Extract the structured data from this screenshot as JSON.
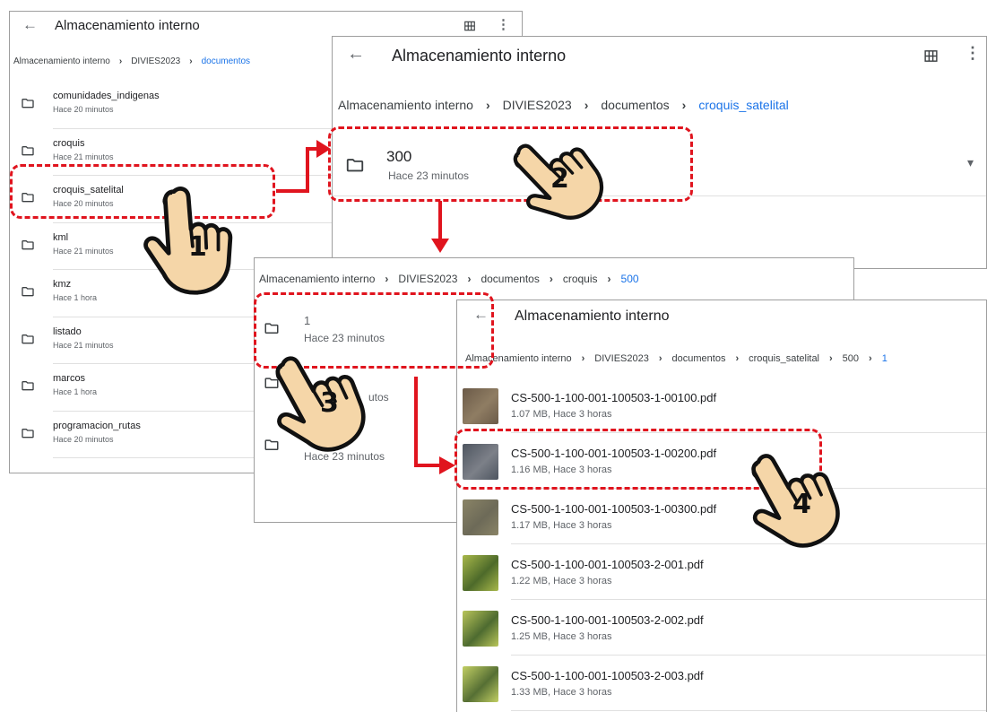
{
  "app_title": "Almacenamiento interno",
  "panel1": {
    "breadcrumb": [
      "Almacenamiento interno",
      "DIVIES2023",
      "documentos"
    ],
    "items": [
      {
        "name": "comunidades_indigenas",
        "meta": "Hace 20 minutos"
      },
      {
        "name": "croquis",
        "meta": "Hace 21 minutos"
      },
      {
        "name": "croquis_satelital",
        "meta": "Hace 20 minutos"
      },
      {
        "name": "kml",
        "meta": "Hace 21 minutos"
      },
      {
        "name": "kmz",
        "meta": "Hace 1 hora"
      },
      {
        "name": "listado",
        "meta": "Hace 21 minutos"
      },
      {
        "name": "marcos",
        "meta": "Hace 1 hora"
      },
      {
        "name": "programacion_rutas",
        "meta": "Hace 20 minutos"
      }
    ]
  },
  "panel2": {
    "breadcrumb": [
      "Almacenamiento interno",
      "DIVIES2023",
      "documentos",
      "croquis_satelital"
    ],
    "items": [
      {
        "name": "300",
        "meta": "Hace 23 minutos"
      }
    ]
  },
  "panel3": {
    "breadcrumb": [
      "Almacenamiento interno",
      "DIVIES2023",
      "documentos",
      "croquis",
      "500"
    ],
    "items": [
      {
        "name": "1",
        "meta": "Hace 23 minutos"
      },
      {
        "name": "",
        "meta": "utos"
      },
      {
        "name": "3",
        "meta": "Hace 23 minutos"
      }
    ]
  },
  "panel4": {
    "breadcrumb": [
      "Almacenamiento interno",
      "DIVIES2023",
      "documentos",
      "croquis_satelital",
      "500",
      "1"
    ],
    "files": [
      {
        "name": "CS-500-1-100-001-100503-1-00100.pdf",
        "meta": "1.07 MB, Hace 3 horas"
      },
      {
        "name": "CS-500-1-100-001-100503-1-00200.pdf",
        "meta": "1.16 MB, Hace 3 horas"
      },
      {
        "name": "CS-500-1-100-001-100503-1-00300.pdf",
        "meta": "1.17 MB, Hace 3 horas"
      },
      {
        "name": "CS-500-1-100-001-100503-2-001.pdf",
        "meta": "1.22 MB, Hace 3 horas"
      },
      {
        "name": "CS-500-1-100-001-100503-2-002.pdf",
        "meta": "1.25 MB, Hace 3 horas"
      },
      {
        "name": "CS-500-1-100-001-100503-2-003.pdf",
        "meta": "1.33 MB, Hace 3 horas"
      }
    ]
  },
  "steps": [
    "1",
    "2",
    "3",
    "4"
  ],
  "icons": {
    "back": "arrow-left-icon",
    "grid": "grid-view-icon",
    "more": "more-vert-icon",
    "folder": "folder-icon",
    "chevron": "chevron-right-icon",
    "expand": "expand-more-icon"
  },
  "colors": {
    "highlight": "#e0141e",
    "current_crumb": "#1a73e8",
    "hand_fill": "#f5d6a8"
  },
  "glyphs": {
    "back": "←",
    "more": "⋮",
    "sep": "›",
    "expand": "▾"
  }
}
